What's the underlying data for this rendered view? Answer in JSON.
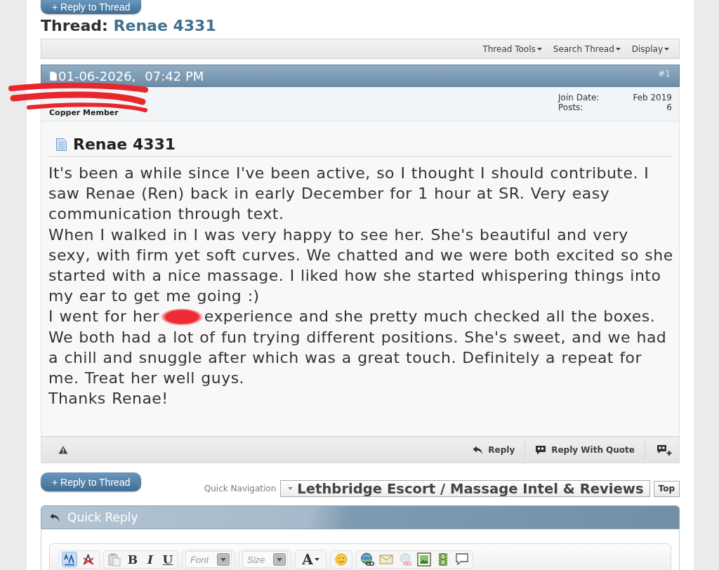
{
  "thread": {
    "reply_button": "+ Reply to Thread",
    "label": "Thread:",
    "title": "Renae 4331",
    "tools": [
      {
        "label": "Thread Tools"
      },
      {
        "label": "Search Thread"
      },
      {
        "label": "Display"
      }
    ]
  },
  "post": {
    "date": "01-06-2026,",
    "time": "07:42 PM",
    "number": "#1",
    "author": {
      "redacted": true,
      "rank": "Copper Member",
      "stats": [
        {
          "label": "Join Date:",
          "value": "Feb 2019"
        },
        {
          "label": "Posts:",
          "value": "6"
        }
      ]
    },
    "title": "Renae 4331",
    "paragraphs": [
      {
        "kind": "text",
        "text": "It's been a while since I've been active, so I thought I should contribute. I saw Renae (Ren) back in early December for 1 hour at SR. Very easy communication through text."
      },
      {
        "kind": "text",
        "text": "When I walked in I was very happy to see her. She's beautiful and very sexy, with firm yet soft curves. We chatted and we were both excited so she started with a nice massage. I liked how she started whispering things into my ear to get me going :)"
      },
      {
        "kind": "redacted",
        "before": "I went for her",
        "after": "experience and she pretty much checked all the boxes."
      },
      {
        "kind": "text",
        "text": "We both had a lot of fun trying different positions. She's sweet, and we had a chill and snuggle after which was a great touch. Definitely a repeat for me. Treat her well guys."
      },
      {
        "kind": "text",
        "text": "Thanks Renae!"
      }
    ],
    "actions": [
      {
        "kind": "report"
      },
      {
        "kind": "reply",
        "label": "Reply"
      },
      {
        "kind": "quote",
        "label": "Reply With Quote"
      },
      {
        "kind": "multiquote"
      }
    ]
  },
  "navigation": {
    "reply_button": "+ Reply to Thread",
    "label": "Quick Navigation",
    "forum": "Lethbridge Escort / Massage Intel & Reviews",
    "top_button": "Top"
  },
  "quick_reply": {
    "title": "Quick Reply",
    "toolbar": [
      [
        {
          "kind": "mode",
          "on": true
        },
        {
          "kind": "clear",
          "on": false
        }
      ],
      [
        {
          "kind": "paste",
          "on": false
        },
        {
          "kind": "bold",
          "label": "B",
          "on": false
        },
        {
          "kind": "italic",
          "label": "I",
          "on": false
        },
        {
          "kind": "underline",
          "label": "U",
          "on": false
        }
      ],
      [
        {
          "kind": "select",
          "placeholder": "Font",
          "on": false
        }
      ],
      [
        {
          "kind": "select",
          "placeholder": "Size",
          "on": false
        }
      ],
      [
        {
          "kind": "color",
          "label": "A",
          "on": false
        }
      ],
      [
        {
          "kind": "smiley",
          "on": false
        }
      ],
      [
        {
          "kind": "link",
          "on": false
        },
        {
          "kind": "email",
          "on": false
        },
        {
          "kind": "unlink",
          "on": false
        },
        {
          "kind": "image",
          "on": false
        },
        {
          "kind": "video",
          "on": false
        },
        {
          "kind": "quote",
          "on": false
        }
      ]
    ]
  }
}
